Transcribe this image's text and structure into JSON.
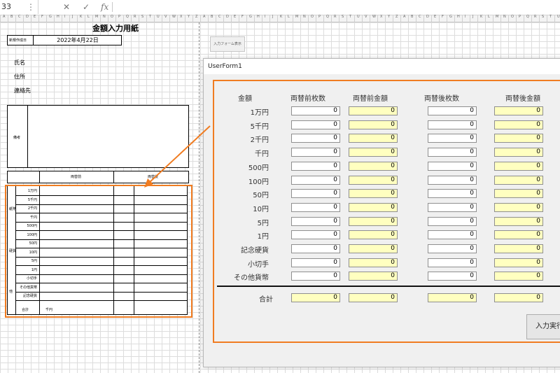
{
  "formula_bar": {
    "name_box": "33",
    "cancel_icon": "✕",
    "enter_icon": "✓",
    "fx_icon": "fx",
    "more_icon": "⋮"
  },
  "sheet": {
    "title": "金額入力用紙",
    "date_label": "新規作成日",
    "date_value": "2022年4月22日",
    "name_label": "氏名",
    "address_label": "住所",
    "contact_label": "連絡先",
    "remarks_label": "備考",
    "before_header": "両替前",
    "after_header": "両替後",
    "section_bills": "紙幣",
    "section_coins": "硬貨",
    "section_other": "他",
    "rows": [
      "1万円",
      "5千円",
      "2千円",
      "千円",
      "500円",
      "100円",
      "50円",
      "10円",
      "5円",
      "1円",
      "小切手",
      "その他貨幣",
      "記念硬貨"
    ],
    "total_label": "合計",
    "total_unit": "千円",
    "form_button": "入力フォーム表示"
  },
  "userform": {
    "title": "UserForm1",
    "headers": {
      "denomination": "金額",
      "before_count": "両替前枚数",
      "before_amount": "両替前金額",
      "after_count": "両替後枚数",
      "after_amount": "両替後金額"
    },
    "rows": [
      {
        "label": "1万円",
        "before_count": "0",
        "before_amount": "0",
        "after_count": "0",
        "after_amount": "0"
      },
      {
        "label": "5千円",
        "before_count": "0",
        "before_amount": "0",
        "after_count": "0",
        "after_amount": "0"
      },
      {
        "label": "2千円",
        "before_count": "0",
        "before_amount": "0",
        "after_count": "0",
        "after_amount": "0"
      },
      {
        "label": "千円",
        "before_count": "0",
        "before_amount": "0",
        "after_count": "0",
        "after_amount": "0"
      },
      {
        "label": "500円",
        "before_count": "0",
        "before_amount": "0",
        "after_count": "0",
        "after_amount": "0"
      },
      {
        "label": "100円",
        "before_count": "0",
        "before_amount": "0",
        "after_count": "0",
        "after_amount": "0"
      },
      {
        "label": "50円",
        "before_count": "0",
        "before_amount": "0",
        "after_count": "0",
        "after_amount": "0"
      },
      {
        "label": "10円",
        "before_count": "0",
        "before_amount": "0",
        "after_count": "0",
        "after_amount": "0"
      },
      {
        "label": "5円",
        "before_count": "0",
        "before_amount": "0",
        "after_count": "0",
        "after_amount": "0"
      },
      {
        "label": "1円",
        "before_count": "0",
        "before_amount": "0",
        "after_count": "0",
        "after_amount": "0"
      },
      {
        "label": "記念硬貨",
        "before_count": "0",
        "before_amount": "0",
        "after_count": "0",
        "after_amount": "0"
      },
      {
        "label": "小切手",
        "before_count": "0",
        "before_amount": "0",
        "after_count": "0",
        "after_amount": "0"
      },
      {
        "label": "その他貨幣",
        "before_count": "0",
        "before_amount": "0",
        "after_count": "0",
        "after_amount": "0"
      }
    ],
    "total": {
      "label": "合計",
      "before_count": "0",
      "before_amount": "0",
      "after_count": "0",
      "after_amount": "0"
    },
    "enter_button": "入力実行"
  },
  "colors": {
    "accent": "#f07c21",
    "calc_field": "#ffffc0"
  }
}
